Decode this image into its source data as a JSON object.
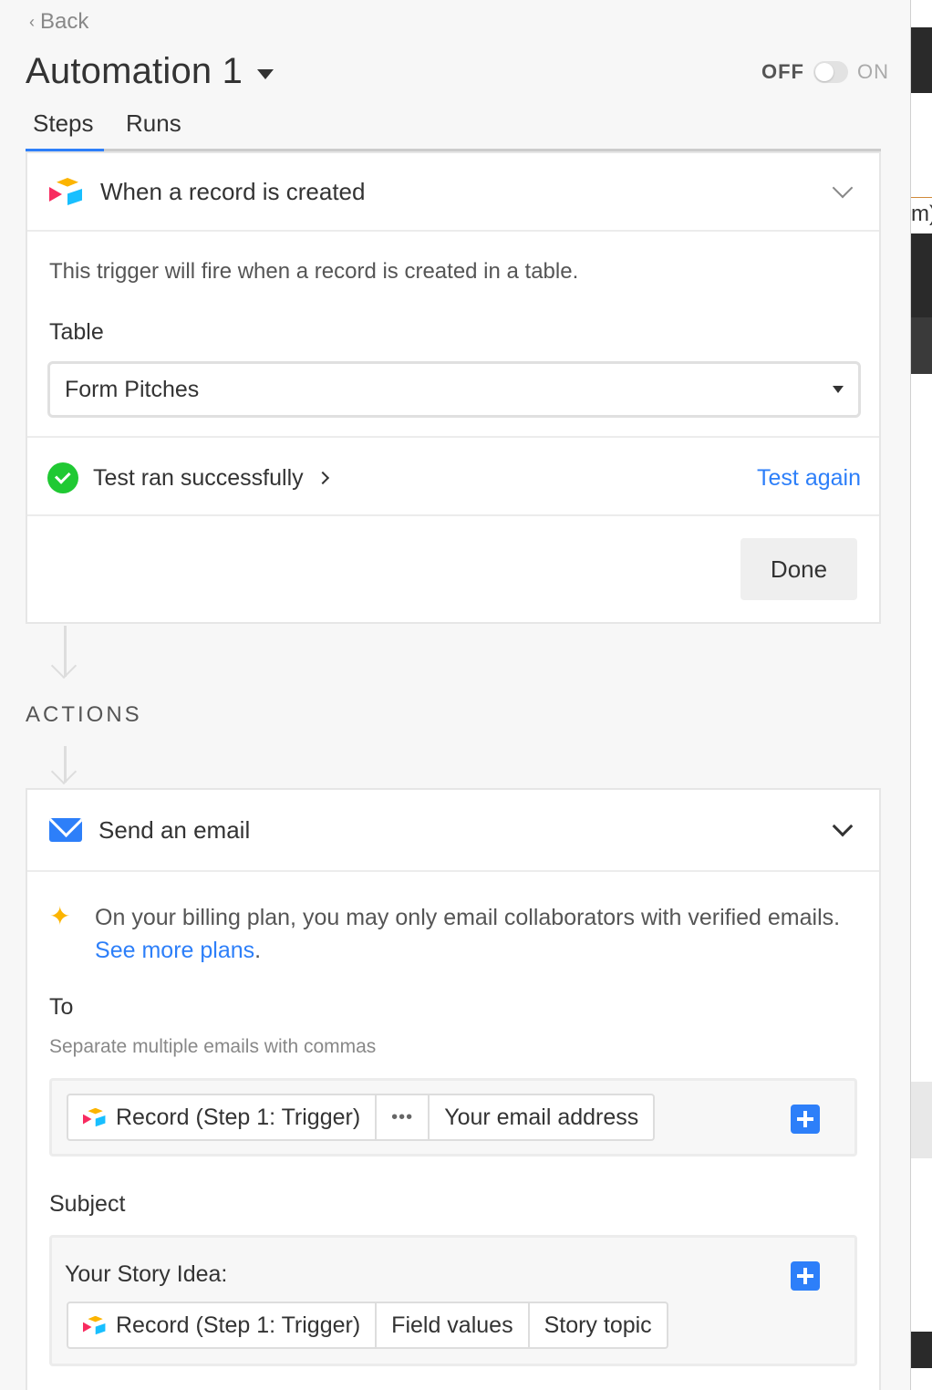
{
  "nav": {
    "back_label": "Back"
  },
  "header": {
    "title": "Automation 1",
    "toggle_off_label": "OFF",
    "toggle_on_label": "ON",
    "toggle_state": "off"
  },
  "tabs": [
    {
      "label": "Steps",
      "active": true
    },
    {
      "label": "Runs",
      "active": false
    }
  ],
  "trigger": {
    "title": "When a record is created",
    "description": "This trigger will fire when a record is created in a table.",
    "table_label": "Table",
    "table_value": "Form Pitches",
    "test_status": "Test ran successfully",
    "test_again_label": "Test again",
    "done_label": "Done"
  },
  "actions_section_label": "ACTIONS",
  "action": {
    "title": "Send an email",
    "notice_text": "On your billing plan, you may only email collaborators with verified emails.",
    "notice_link": "See more plans",
    "notice_end": ".",
    "to_label": "To",
    "to_hint": "Separate multiple emails with commas",
    "to_tokens": [
      "Record (Step 1: Trigger)",
      "•••",
      "Your email address"
    ],
    "subject_label": "Subject",
    "subject_text": "Your Story Idea:",
    "subject_tokens": [
      "Record (Step 1: Trigger)",
      "Field values",
      "Story topic"
    ]
  },
  "right_edge_peek": "m)",
  "colors": {
    "accent": "#2d7ff9",
    "success": "#20c933",
    "logo_yellow": "#fcb400",
    "logo_red": "#f82b60",
    "logo_blue": "#18bfff"
  },
  "icons": [
    "chevron-left-icon",
    "caret-down-icon",
    "airtable-logo-icon",
    "chevron-down-icon",
    "check-circle-icon",
    "chevron-right-icon",
    "envelope-icon",
    "sparkle-icon",
    "plus-icon",
    "ellipsis-icon"
  ]
}
